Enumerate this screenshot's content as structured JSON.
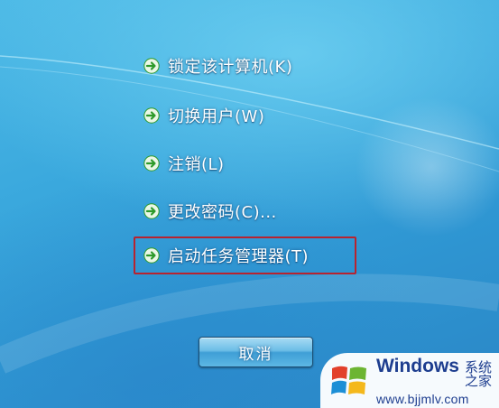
{
  "menu": {
    "items": [
      {
        "label": "锁定该计算机(K)",
        "icon": "green-arrow-icon"
      },
      {
        "label": "切换用户(W)",
        "icon": "green-arrow-icon"
      },
      {
        "label": "注销(L)",
        "icon": "green-arrow-icon"
      },
      {
        "label": "更改密码(C)...",
        "icon": "green-arrow-icon"
      },
      {
        "label": "启动任务管理器(T)",
        "icon": "green-arrow-icon",
        "highlighted": true
      }
    ]
  },
  "cancel_button": {
    "label": "取消"
  },
  "watermark": {
    "brand": "Windows",
    "brand_cn": "系统之家",
    "url": "www.bjjmlv.com"
  },
  "colors": {
    "arrow_green": "#2e9a2a",
    "highlight_border": "#b8232f",
    "brand_blue": "#1d3d8f",
    "logo_red": "#e2402b",
    "logo_green": "#6cb532",
    "logo_blue": "#1c8fd6",
    "logo_yellow": "#f4b81c"
  }
}
